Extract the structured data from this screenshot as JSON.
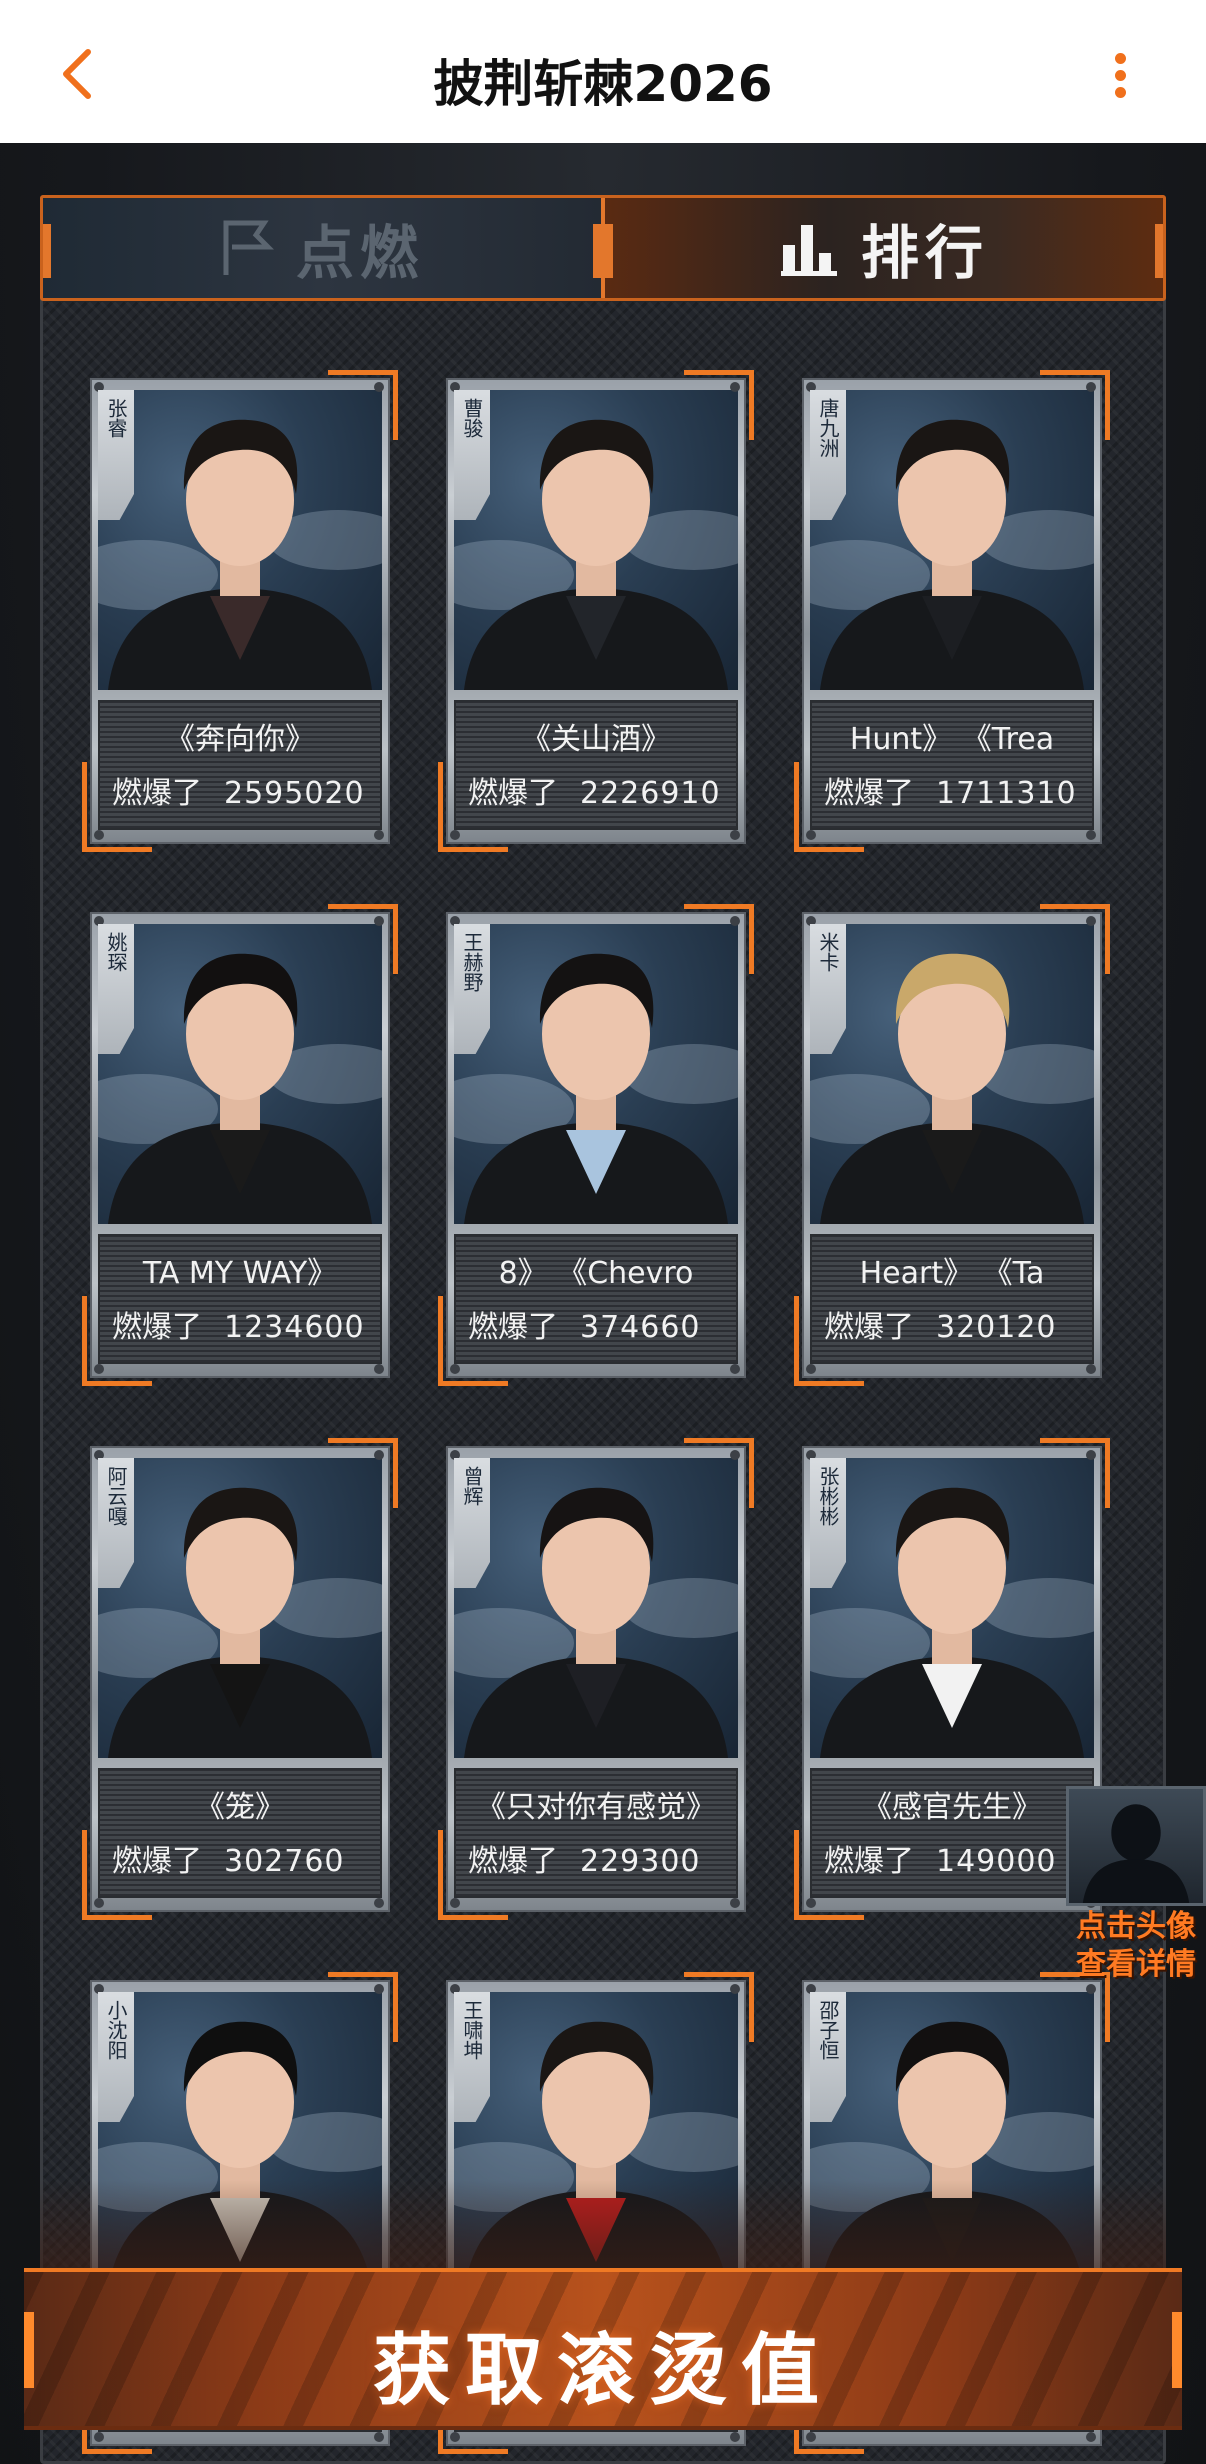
{
  "header": {
    "title": "披荆斩棘2026",
    "back_icon": "chevron-left-icon",
    "more_icon": "vertical-dots-icon",
    "accent": "#f0701c"
  },
  "tabs": [
    {
      "label": "点燃",
      "icon": "flag-icon",
      "active": false
    },
    {
      "label": "排行",
      "icon": "bar-chart-icon",
      "active": true
    }
  ],
  "score_label": "燃爆了",
  "cards": [
    {
      "name": "张睿",
      "song": "《奔向你》",
      "score": "2595020"
    },
    {
      "name": "曹骏",
      "song": "《关山酒》",
      "score": "2226910"
    },
    {
      "name": "唐九洲",
      "song": "Hunt》          《Trea",
      "score": "1711310"
    },
    {
      "name": "姚琛",
      "song": "TA MY WAY》",
      "score": "1234600"
    },
    {
      "name": "王赫野",
      "song": "8》          《Chevro",
      "score": "374660"
    },
    {
      "name": "米卡",
      "song": "Heart》          《Ta",
      "score": "320120"
    },
    {
      "name": "阿云嘎",
      "song": "《笼》",
      "score": "302760"
    },
    {
      "name": "曾辉",
      "song": "《只对你有感觉》",
      "score": "229300"
    },
    {
      "name": "张彬彬",
      "song": "《感官先生》",
      "score": "149000"
    },
    {
      "name": "小沈阳",
      "song": "",
      "score": ""
    },
    {
      "name": "王啸坤",
      "song": "",
      "score": ""
    },
    {
      "name": "邵子恒",
      "song": "",
      "score": ""
    }
  ],
  "hint": {
    "line1": "点击头像",
    "line2": "查看详情"
  },
  "cta": {
    "label": "获取滚烫值"
  }
}
